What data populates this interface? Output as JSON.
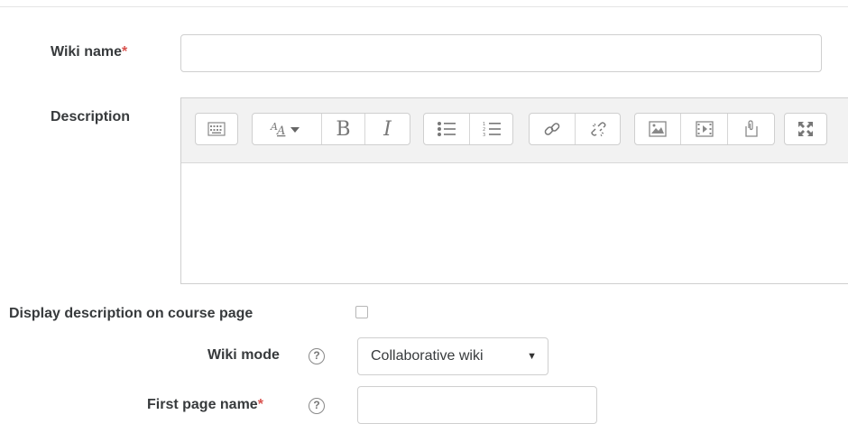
{
  "fields": {
    "wiki_name": {
      "label": "Wiki name",
      "required_mark": "*",
      "value": ""
    },
    "description": {
      "label": "Description",
      "value": ""
    },
    "display_description": {
      "label": "Display description on course page",
      "checked": false
    },
    "wiki_mode": {
      "label": "Wiki mode",
      "help_glyph": "?",
      "selected": "Collaborative wiki",
      "caret": "▼"
    },
    "first_page_name": {
      "label": "First page name",
      "required_mark": "*",
      "help_glyph": "?",
      "value": ""
    }
  },
  "editor_toolbar": [
    [
      "show-more-buttons-icon"
    ],
    [
      "font-style-icon",
      "bold-icon",
      "italic-icon"
    ],
    [
      "unordered-list-icon",
      "ordered-list-icon"
    ],
    [
      "link-icon",
      "unlink-icon"
    ],
    [
      "image-icon",
      "media-icon",
      "manage-files-icon"
    ],
    [
      "fullscreen-icon"
    ]
  ],
  "editor_glyphs": {
    "bold": "B",
    "italic": "I"
  },
  "colors": {
    "required": "#d9534f",
    "toolbar_bg": "#f2f2f2",
    "border": "#cfcfcf"
  }
}
